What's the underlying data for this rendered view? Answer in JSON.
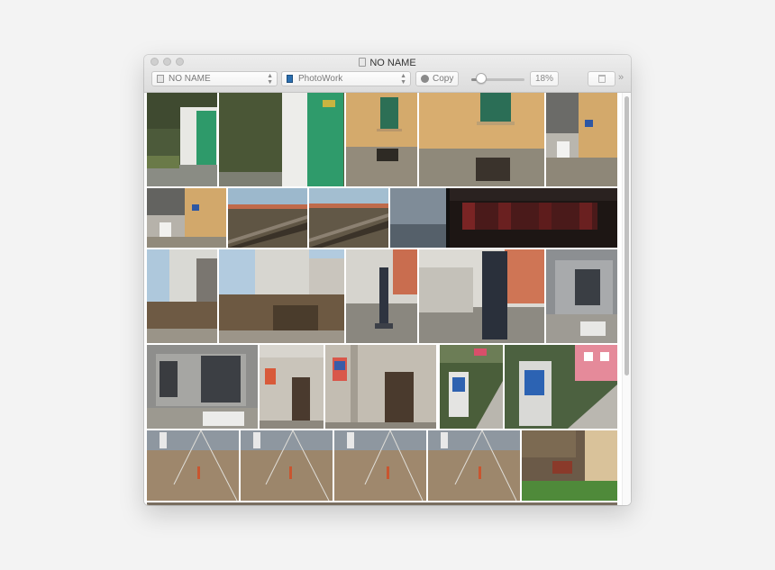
{
  "window": {
    "title": "NO NAME",
    "device_selector": {
      "value": "NO NAME",
      "icon": "drive-icon"
    },
    "album_selector": {
      "value": "PhotoWork",
      "icon": "app-icon"
    },
    "copy_button": {
      "label": "Copy",
      "icon": "download-icon"
    },
    "zoom": {
      "value": "18%",
      "fraction": 0.18
    },
    "trash_button": {
      "icon": "trash-icon"
    },
    "overflow_button": {
      "label": "»"
    }
  },
  "colors": {
    "accent_green": "#2e9a6a",
    "wall_ochre": "#d2a86b",
    "stone": "#8c8474"
  }
}
